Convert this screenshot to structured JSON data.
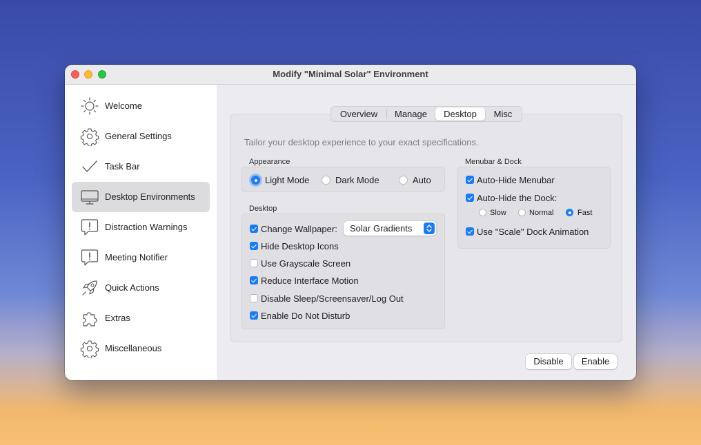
{
  "window": {
    "title": "Modify \"Minimal Solar\" Environment"
  },
  "sidebar": {
    "items": [
      {
        "label": "Welcome",
        "icon": "sun-icon"
      },
      {
        "label": "General Settings",
        "icon": "gear-icon"
      },
      {
        "label": "Task Bar",
        "icon": "checkmark-icon"
      },
      {
        "label": "Desktop Environments",
        "icon": "monitor-icon",
        "selected": true
      },
      {
        "label": "Distraction Warnings",
        "icon": "alert-bubble-icon"
      },
      {
        "label": "Meeting Notifier",
        "icon": "alert-bubble-icon"
      },
      {
        "label": "Quick Actions",
        "icon": "rocket-icon"
      },
      {
        "label": "Extras",
        "icon": "puzzle-icon"
      },
      {
        "label": "Miscellaneous",
        "icon": "gear-icon"
      }
    ]
  },
  "tabs": {
    "items": [
      "Overview",
      "Manage",
      "Desktop",
      "Misc"
    ],
    "active": "Desktop"
  },
  "description": "Tailor your desktop experience to your exact specifications.",
  "appearance": {
    "label": "Appearance",
    "options": [
      "Light Mode",
      "Dark Mode",
      "Auto"
    ],
    "selected": "Light Mode"
  },
  "desktop": {
    "label": "Desktop",
    "change_wallpaper": {
      "label": "Change Wallpaper:",
      "checked": true
    },
    "wallpaper_select": {
      "value": "Solar Gradients"
    },
    "options": [
      {
        "label": "Hide Desktop Icons",
        "checked": true
      },
      {
        "label": "Use Grayscale Screen",
        "checked": false
      },
      {
        "label": "Reduce Interface Motion",
        "checked": true
      },
      {
        "label": "Disable Sleep/Screensaver/Log Out",
        "checked": false
      },
      {
        "label": "Enable Do Not Disturb",
        "checked": true
      }
    ]
  },
  "menubar_dock": {
    "label": "Menubar & Dock",
    "auto_hide_menubar": {
      "label": "Auto-Hide Menubar",
      "checked": true
    },
    "auto_hide_dock": {
      "label": "Auto-Hide the Dock:",
      "checked": true
    },
    "dock_speed": {
      "options": [
        "Slow",
        "Normal",
        "Fast"
      ],
      "selected": "Fast"
    },
    "scale_animation": {
      "label": "Use \"Scale\" Dock Animation",
      "checked": true
    }
  },
  "buttons": {
    "disable": "Disable",
    "enable": "Enable"
  },
  "colors": {
    "accent": "#1a7cf5"
  }
}
